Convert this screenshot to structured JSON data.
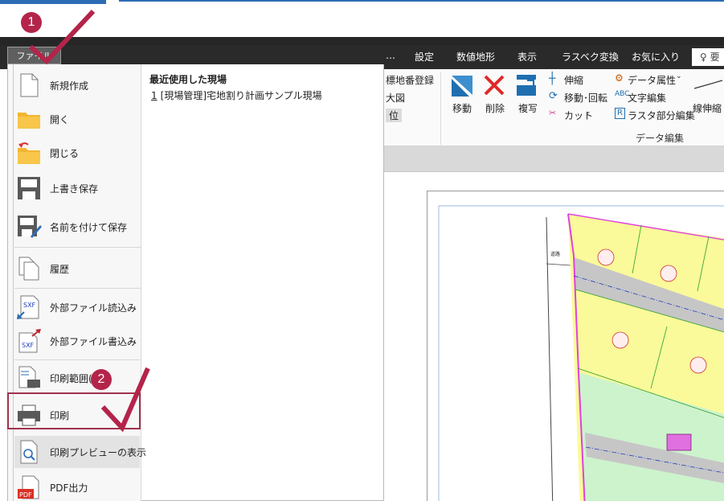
{
  "menubar": {
    "file_tab": "ファイル",
    "items": [
      "…",
      "設定",
      "数値地形",
      "表示",
      "ラスベク変換",
      "お気に入り"
    ],
    "search_glyph": "♀ 要"
  },
  "ribbon": {
    "partial": [
      "標地番登録",
      "大図",
      "位"
    ],
    "move": "移動",
    "delete": "削除",
    "copy": "複写",
    "stretch": "伸縮",
    "move_rotate": "移動･回転",
    "cut": "カット",
    "data_attr": "データ属性",
    "text_edit": "文字編集",
    "raster_edit": "ラスタ部分編集",
    "line_stretch": "線伸縮",
    "group_label": "データ編集"
  },
  "file_menu": {
    "items": [
      {
        "label": "新規作成",
        "icon": "new-doc-icon"
      },
      {
        "label": "開く",
        "icon": "folder-open-icon"
      },
      {
        "label": "閉じる",
        "icon": "folder-close-icon"
      },
      {
        "label": "上書き保存",
        "icon": "save-icon"
      },
      {
        "label": "名前を付けて保存",
        "icon": "save-as-icon"
      },
      {
        "label": "履歴",
        "icon": "history-icon"
      },
      {
        "label": "外部ファイル読込み",
        "icon": "sxf-import-icon"
      },
      {
        "label": "外部ファイル書込み",
        "icon": "sxf-export-icon"
      },
      {
        "label": "印刷範囲(",
        "icon": "print-range-icon"
      },
      {
        "label": "印刷",
        "icon": "printer-icon"
      },
      {
        "label": "印刷プレビューの表示",
        "icon": "print-preview-icon"
      },
      {
        "label": "PDF出力",
        "icon": "pdf-icon"
      }
    ],
    "icon_text": {
      "sxf": "SXF",
      "pdf": "PDF"
    },
    "recent_title": "最近使用した現場",
    "recent_num": "1",
    "recent_item": "[現場管理]宅地割り計画サンプル現場"
  },
  "badges": {
    "step1": "1",
    "step2": "2"
  },
  "drawing": {
    "road_label": "道路",
    "colors": {
      "lot_yellow": "#fafa9a",
      "lot_green": "#cdf3cd",
      "road_gray": "#c6c6c6",
      "lot_line": "#2f9e2f",
      "boundary": "#e040e0",
      "center_line": "#1f3fbf"
    }
  },
  "colors": {
    "accent": "#2d6cb4",
    "badge": "#b4244a",
    "callout": "#a0334d",
    "menubar": "#2a2a2a"
  }
}
